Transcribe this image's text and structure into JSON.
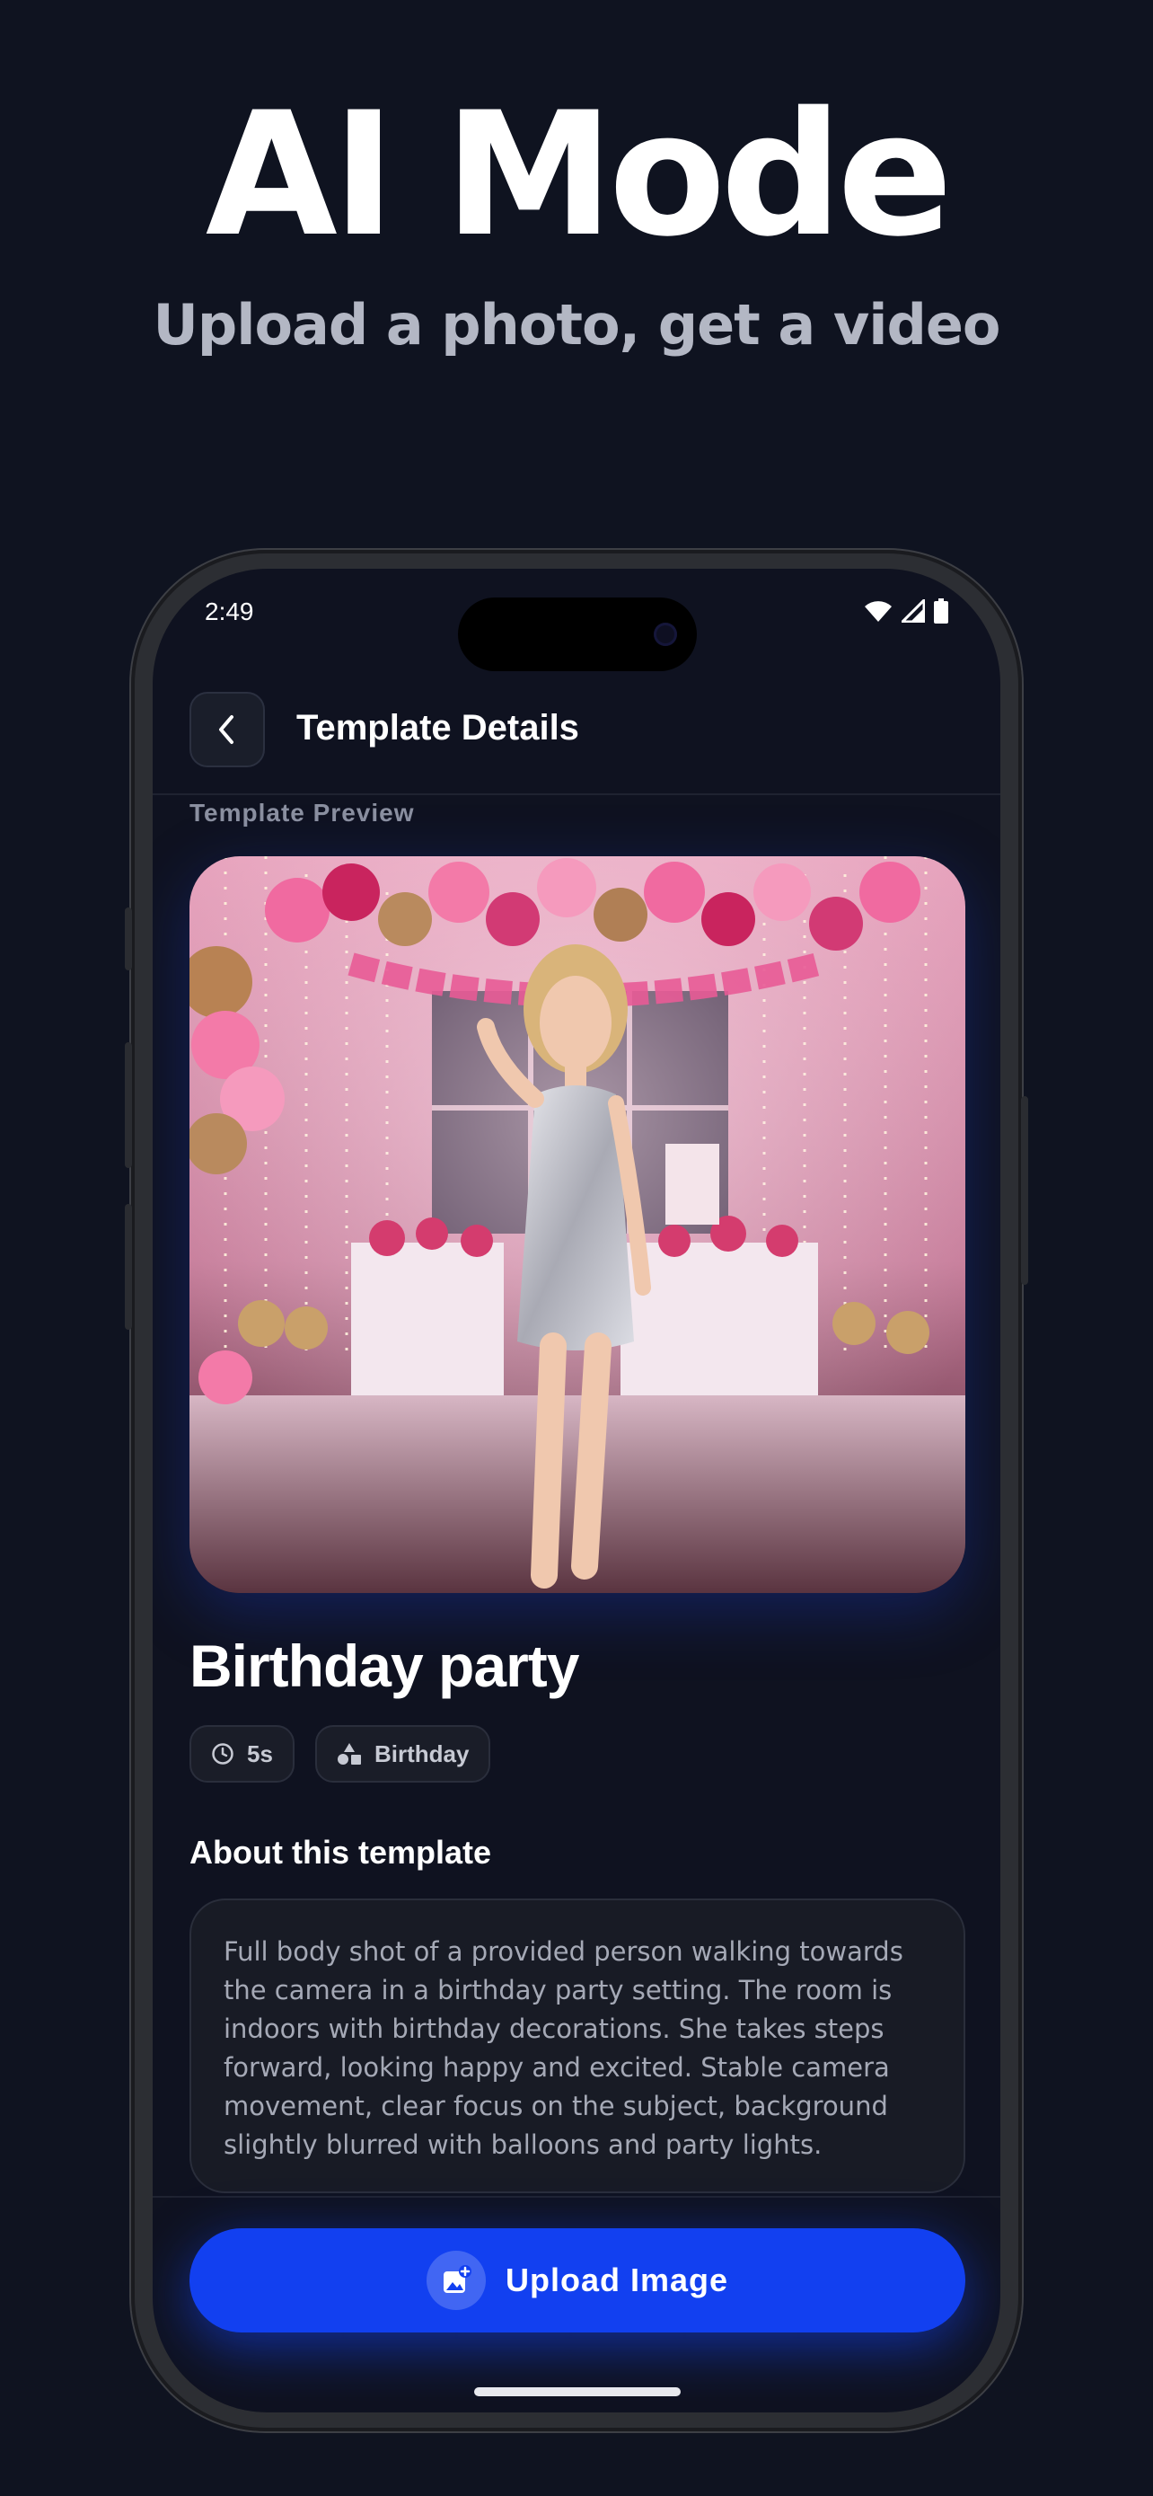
{
  "hero": {
    "title": "AI Mode",
    "subtitle": "Upload a photo, get a video"
  },
  "status_bar": {
    "time": "2:49",
    "icons": [
      "wifi-icon",
      "cellular-signal-icon",
      "battery-icon"
    ]
  },
  "header": {
    "back_icon": "chevron-left-icon",
    "title": "Template Details"
  },
  "preview": {
    "label": "Template Preview",
    "image_description_icon": "birthday-party-photo"
  },
  "template": {
    "title": "Birthday party",
    "chips": [
      {
        "icon": "clock-icon",
        "label": "5s"
      },
      {
        "icon": "category-shapes-icon",
        "label": "Birthday"
      }
    ],
    "about_title": "About this template",
    "description": "Full body shot of a provided person walking towards the camera in a birthday party setting. The room is indoors with birthday decorations. She takes steps forward, looking happy and excited. Stable camera movement, clear focus on the subject, background slightly blurred with balloons and party lights."
  },
  "actions": {
    "upload_label": "Upload Image",
    "upload_icon": "add-photo-icon"
  },
  "colors": {
    "background": "#0f1320",
    "primary_button": "#1240f0",
    "chip_bg": "#1a1d28",
    "text_muted": "#a5a9b6"
  }
}
